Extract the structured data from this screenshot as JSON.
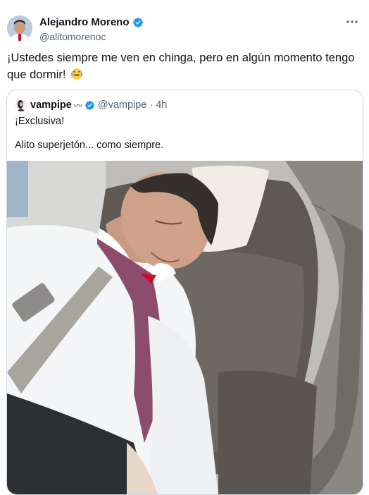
{
  "tweet": {
    "author_name": "Alejandro Moreno",
    "author_handle": "@alitomorenoc",
    "text": "¡Ustedes siempre me ven en chinga, pero en algún momento tengo que dormir!",
    "emoji_icon": "tears-of-joy-emoji",
    "verified_color": "#1d9bf0"
  },
  "quote": {
    "name": "vampipe",
    "name_suffix": "〰",
    "handle": "@vampipe",
    "separator": "·",
    "time": "4h",
    "line1": "¡Exclusiva!",
    "line2": "Alito superjetón... como siempre."
  }
}
